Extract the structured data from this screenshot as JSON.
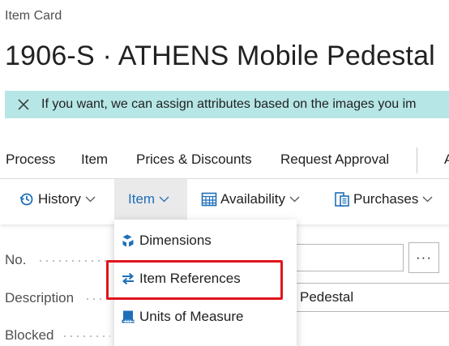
{
  "header": {
    "kind": "Item Card",
    "title": "1906-S · ATHENS Mobile Pedestal"
  },
  "banner": {
    "text": "If you want, we can assign attributes based on the images you im",
    "close_icon": "close-icon",
    "color": "#b6e6e6"
  },
  "actions": {
    "process": "Process",
    "item": "Item",
    "prices": "Prices & Discounts",
    "request_approval": "Request Approval",
    "overflow": "A"
  },
  "subactions": {
    "history": "History",
    "item": "Item",
    "availability": "Availability",
    "purchases": "Purchases",
    "active_color": "#1f6fb8"
  },
  "item_menu": {
    "items": [
      {
        "label": "Dimensions",
        "icon": "dimensions-icon"
      },
      {
        "label": "Item References",
        "icon": "item-references-icon"
      },
      {
        "label": "Units of Measure",
        "icon": "units-of-measure-icon"
      }
    ],
    "highlight_color": "#e0141e"
  },
  "fields": {
    "no_label": "No.",
    "description_label": "Description",
    "description_value": "Pedestal",
    "blocked_label": "Blocked",
    "lookup_label": "···"
  }
}
